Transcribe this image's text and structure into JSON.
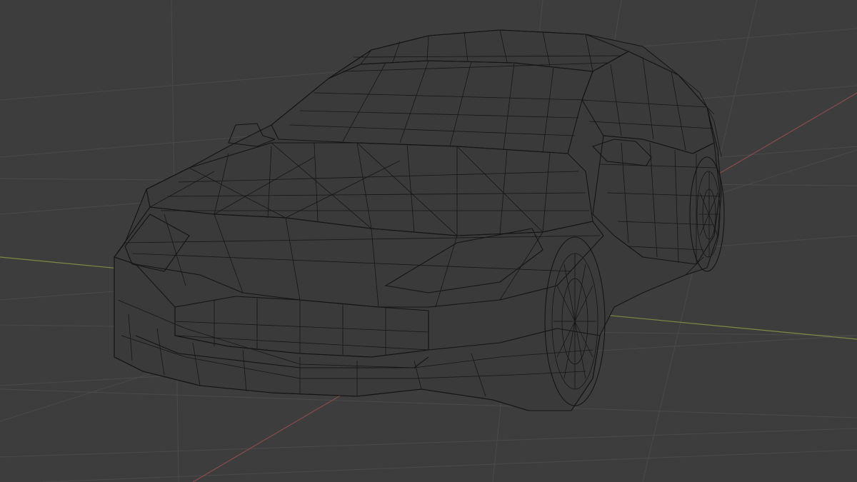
{
  "viewport": {
    "mode": "3D viewport",
    "shading": "wireframe",
    "object": "car",
    "colors": {
      "background": "#3d3d3d",
      "grid": "#4a4a4a",
      "x_axis": "#8a4b4b",
      "y_axis": "#7d8a42",
      "wire": "#141414"
    }
  }
}
